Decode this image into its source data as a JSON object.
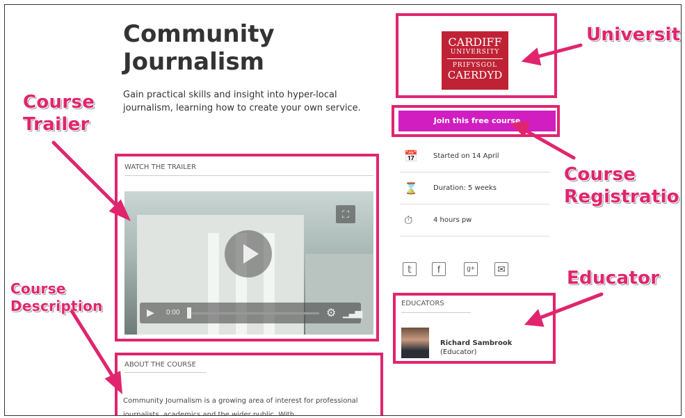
{
  "course": {
    "title_line1": "Community",
    "title_line2": "Journalism",
    "subtitle": "Gain practical skills and insight into hyper-local journalism, learning how to create your own service."
  },
  "trailer": {
    "section_label": "WATCH THE TRAILER",
    "time": "0:00"
  },
  "about": {
    "section_label": "ABOUT THE COURSE",
    "text": "Community Journalism is a growing area of interest for professional journalists, academics and the wider public. With"
  },
  "university": {
    "line1": "CARDIFF",
    "line2": "UNIVERSITY",
    "line3": "PRIFYSGOL",
    "line4": "CAERDYD"
  },
  "registration": {
    "button_label": "Join this free course"
  },
  "info": {
    "started": "Started on 14 April",
    "duration": "Duration: 5 weeks",
    "hours": "4 hours pw"
  },
  "educators": {
    "section_label": "EDUCATORS",
    "name": "Richard Sambrook",
    "role": "(Educator)"
  },
  "callouts": {
    "university": "University",
    "course_trailer_1": "Course",
    "course_trailer_2": "Trailer",
    "course_registration_1": "Course",
    "course_registration_2": "Registration",
    "educator": "Educator",
    "course_description_1": "Course",
    "course_description_2": "Description"
  },
  "colors": {
    "highlight": "#e0256e",
    "join_button": "#d01ec0",
    "university_red": "#c02235"
  },
  "icons": [
    "calendar-icon",
    "hourglass-icon",
    "stopwatch-icon",
    "twitter-icon",
    "facebook-icon",
    "google-plus-icon",
    "email-icon",
    "play-icon",
    "expand-icon",
    "settings-icon",
    "volume-icon"
  ]
}
